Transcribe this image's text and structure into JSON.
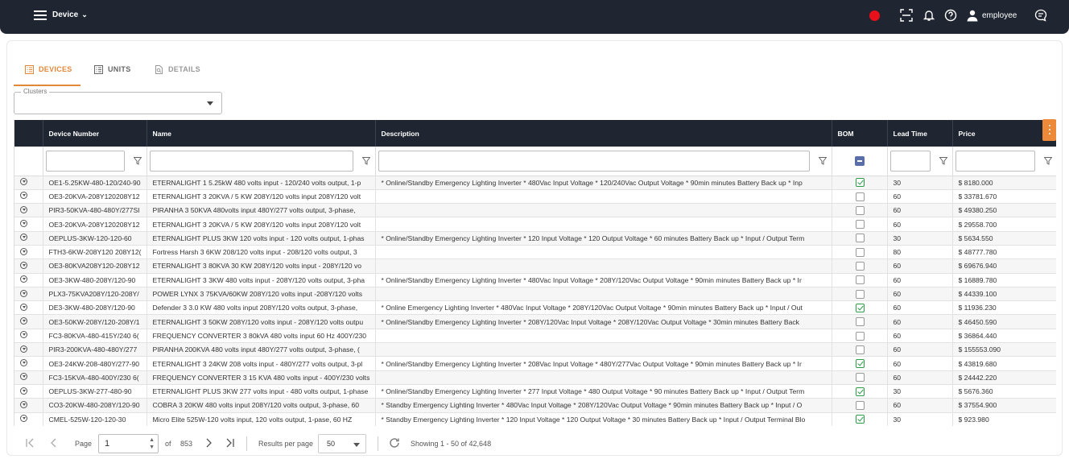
{
  "header": {
    "app_name": "Device",
    "user_name": "employee",
    "icons": [
      "menu-icon",
      "record-icon",
      "scan-icon",
      "bell-icon",
      "help-icon",
      "user-icon",
      "chat-icon"
    ]
  },
  "tabs": [
    {
      "label": "DEVICES",
      "icon": "list-icon",
      "active": true
    },
    {
      "label": "UNITS",
      "icon": "list-icon",
      "active": false
    },
    {
      "label": "DETAILS",
      "icon": "details-icon",
      "active": false
    }
  ],
  "clusters": {
    "label": "Clusters",
    "value": ""
  },
  "table": {
    "columns": [
      "Device Number",
      "Name",
      "Description",
      "BOM",
      "Lead Time",
      "Price"
    ],
    "rows": [
      {
        "device": "OE1-5.25KW-480-120/240-90",
        "name": "ETERNALIGHT 1 5.25kW 480 volts input - 120/240 volts output, 1-p",
        "desc": "* Online/Standby Emergency Lighting Inverter * 480Vac Input Voltage * 120/240Vac Output Voltage * 90min minutes Battery Back up * Inp",
        "bom": true,
        "lead": "30",
        "price": "$ 8180.000"
      },
      {
        "device": "OE3-20KVA-208Y120208Y12",
        "name": "ETERNALIGHT 3 20KVA / 5 KW 208Y/120 volts input 208Y/120 volt",
        "desc": "",
        "bom": false,
        "lead": "60",
        "price": "$ 33781.670"
      },
      {
        "device": "PIR3-50KVA-480-480Y/277SI",
        "name": "PIRANHA 3 50KVA 480volts input 480Y/277 volts output, 3-phase,",
        "desc": "",
        "bom": false,
        "lead": "60",
        "price": "$ 49380.250"
      },
      {
        "device": "OE3-20KVA-208Y120208Y12",
        "name": "ETERNALIGHT 3 20KVA / 5 KW 208Y/120 volts input 208Y/120 volt",
        "desc": "",
        "bom": false,
        "lead": "60",
        "price": "$ 29558.700"
      },
      {
        "device": "OEPLUS-3KW-120-120-60",
        "name": "ETERNALIGHT PLUS 3KW 120 volts input - 120 volts output, 1-phas",
        "desc": "* Online/Standby Emergency Lighting Inverter * 120 Input Voltage * 120 Output Voltage * 60 minutes Battery Back up * Input / Output Term",
        "bom": false,
        "lead": "30",
        "price": "$ 5634.550"
      },
      {
        "device": "FTH3-6KW-208Y120 208Y12(",
        "name": "Fortress Harsh 3 6KW 208/120 volts input - 208/120 volts output, 3",
        "desc": "",
        "bom": false,
        "lead": "80",
        "price": "$ 48777.780"
      },
      {
        "device": "OE3-80KVA208Y120-208Y12",
        "name": "ETERNALIGHT 3 80KVA 30 KW 208Y/120 volts input - 208Y/120 vo",
        "desc": "",
        "bom": false,
        "lead": "60",
        "price": "$ 69676.940"
      },
      {
        "device": "OE3-3KW-480-208Y/120-90",
        "name": "ETERNALIGHT 3 3KW 480 volts input - 208Y/120 volts output, 3-pha",
        "desc": "* Online/Standby Emergency Lighting Inverter * 480Vac Input Voltage * 208Y/120Vac Output Voltage * 90min minutes Battery Back up * Ir",
        "bom": false,
        "lead": "60",
        "price": "$ 16889.780"
      },
      {
        "device": "PLX3-75KVA208Y/120-208Y/",
        "name": "POWER LYNX 3 75KVA/60KW 208Y/120 volts input -208Y/120 volts",
        "desc": "",
        "bom": false,
        "lead": "60",
        "price": "$ 44339.100"
      },
      {
        "device": "DE3-3KW-480-208Y/120-90",
        "name": "Defender 3 3.0 KW 480 volts input 208Y/120 volts output, 3-phase,",
        "desc": "* Online Emergency Lighting Inverter * 480Vac Input Voltage * 208Y/120Vac Output Voltage * 90min minutes Battery Back up * Input / Out",
        "bom": true,
        "lead": "60",
        "price": "$ 11936.230"
      },
      {
        "device": "OE3-50KW-208Y/120-208Y/1",
        "name": "ETERNALIGHT 3 50KW 208Y/120 volts input - 208Y/120 volts outpu",
        "desc": "* Online/Standby Emergency Lighting Inverter * 208Y/120Vac Input Voltage * 208Y/120Vac Output Voltage * 30min minutes Battery Back",
        "bom": false,
        "lead": "60",
        "price": "$ 46450.590"
      },
      {
        "device": "FC3-80KVA-480-415Y/240 6(",
        "name": "FREQUENCY CONVERTER 3 80kVA 480 volts input 60 Hz 400Y/230",
        "desc": "",
        "bom": false,
        "lead": "60",
        "price": "$ 36864.440"
      },
      {
        "device": "PIR3-200KVA-480-480Y/277",
        "name": "PIRANHA 200KVA 480 volts input 480Y/277 volts output, 3-phase, (",
        "desc": "",
        "bom": false,
        "lead": "60",
        "price": "$ 155553.090"
      },
      {
        "device": "OE3-24KW-208-480Y/277-90",
        "name": "ETERNALIGHT 3 24KW 208 volts input - 480Y/277 volts output, 3-pl",
        "desc": "* Online/Standby Emergency Lighting Inverter * 208Vac Input Voltage * 480Y/277Vac Output Voltage * 90min minutes Battery Back up * Ir",
        "bom": true,
        "lead": "60",
        "price": "$ 43819.680"
      },
      {
        "device": "FC3-15KVA-480-400Y/230 6(",
        "name": "FREQUENCY CONVERTER 3 15 KVA 480 volts input - 400Y/230 volts",
        "desc": "",
        "bom": false,
        "lead": "60",
        "price": "$ 24442.220"
      },
      {
        "device": "OEPLUS-3KW-277-480-90",
        "name": "ETERNALIGHT PLUS 3KW 277 volts input - 480 volts output, 1-phase",
        "desc": "* Online/Standby Emergency Lighting Inverter * 277 Input Voltage * 480 Output Voltage * 90 minutes Battery Back up * Input / Output Term",
        "bom": true,
        "lead": "30",
        "price": "$ 5676.360"
      },
      {
        "device": "CO3-20KW-480-208Y/120-90",
        "name": "COBRA 3 20KW 480 volts input 208Y/120 volts output, 3-phase, 60",
        "desc": "* Standby Emergency Lighting Inverter * 480Vac Input Voltage * 208Y/120Vac Output Voltage * 90min minutes Battery Back up * Input / O",
        "bom": false,
        "lead": "60",
        "price": "$ 37554.900"
      },
      {
        "device": "CMEL-525W-120-120-30",
        "name": "Micro Elite 525W-120 volts input, 120 volts output, 1-pase, 60 HZ",
        "desc": "* Standby Emergency Lighting Inverter * 120 Input Voltage * 120 Output Voltage * 30 minutes Battery Back up * Input / Output Terminal Blo",
        "bom": true,
        "lead": "30",
        "price": "$ 923.980"
      }
    ]
  },
  "pager": {
    "page_label": "Page",
    "page_value": "1",
    "of_label": "of",
    "total_pages": "853",
    "results_label": "Results per page",
    "per_page": "50",
    "showing": "Showing 1 - 50 of 42,648"
  }
}
